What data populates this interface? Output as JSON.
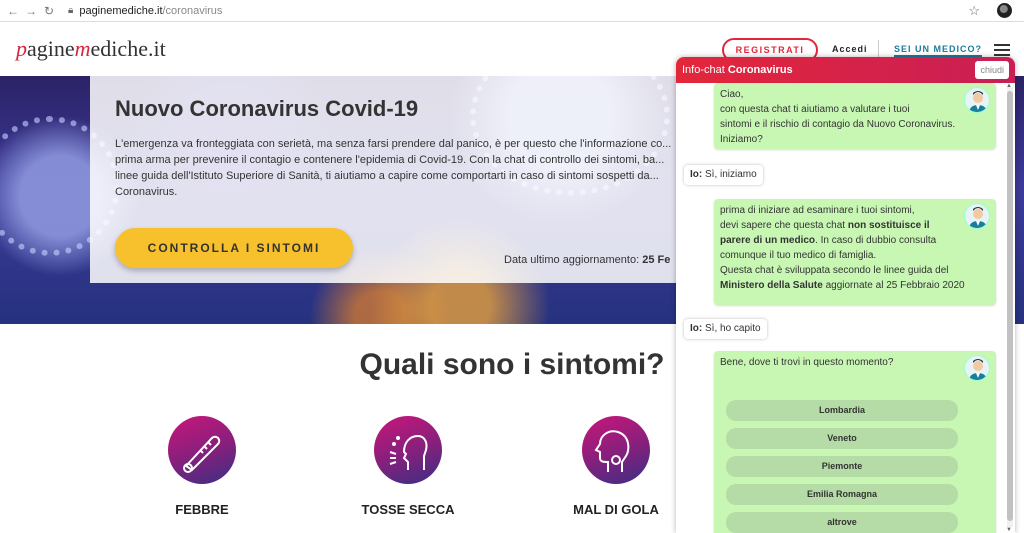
{
  "browser": {
    "back": "←",
    "forward": "→",
    "reload": "↻",
    "url_domain": "paginemediche.it",
    "url_path": "/coronavirus"
  },
  "header": {
    "logo_p": "p",
    "logo_agine": "agine",
    "logo_m": "m",
    "logo_rest": "ediche.it",
    "registrati": "REGISTRATI",
    "accedi": "Accedi",
    "sei_un_medico": "SEI UN MEDICO?"
  },
  "hero": {
    "title": "Nuovo Coronavirus Covid-19",
    "text": "L'emergenza va fronteggiata con serietà, ma senza farsi prendere dal panico, è per questo che l'informazione co... prima arma per prevenire il contagio e contenere l'epidemia di Covid-19. Con la chat di controllo dei sintomi, ba... linee guida dell'Istituto Superiore di Sanità, ti aiutiamo a capire come comportarti in caso di sintomi sospetti da... Coronavirus.",
    "cta": "CONTROLLA I SINTOMI",
    "update_label": "Data ultimo aggiornamento:",
    "update_value": "25 Fe"
  },
  "symptoms": {
    "title": "Quali sono i sintomi?",
    "items": [
      {
        "label": "FEBBRE",
        "icon": "thermometer-icon"
      },
      {
        "label": "TOSSE SECCA",
        "icon": "cough-icon"
      },
      {
        "label": "MAL DI GOLA",
        "icon": "sore-throat-icon"
      }
    ]
  },
  "chat": {
    "title_prefix": "Info-chat",
    "title_bold": "Coronavirus",
    "close": "chiudi",
    "msg1": {
      "l1": "Ciao,",
      "l2": "con questa chat ti aiutiamo a valutare i tuoi",
      "l3": "sintomi e il rischio di contagio da Nuovo Coronavirus.",
      "l4": "Iniziamo?"
    },
    "user1_label": "Io:",
    "user1_text": "Sì, iniziamo",
    "msg2": {
      "a": "prima di iniziare ad esaminare i tuoi sintomi,",
      "b": "devi sapere che questa chat",
      "b_bold": "non sostituisce il",
      "c_bold": "parere di un medico",
      "c": ". In caso di dubbio consulta",
      "d": "comunque il tuo medico di famiglia.",
      "e": "Questa chat è sviluppata secondo le linee guida del",
      "f_bold": "Ministero della Salute",
      "f": " aggiornate al 25 Febbraio 2020"
    },
    "user2_label": "Io:",
    "user2_text": "Sì, ho capito",
    "msg3": "Bene, dove ti trovi in questo momento?",
    "options": [
      "Lombardia",
      "Veneto",
      "Piemonte",
      "Emilia Romagna",
      "altrove"
    ]
  },
  "colors": {
    "brand_red": "#e2263d",
    "cta_yellow": "#f6c12d",
    "chat_bot": "#c8f7b4",
    "option_green": "#b5dca6",
    "link_teal": "#1a7d9c"
  }
}
